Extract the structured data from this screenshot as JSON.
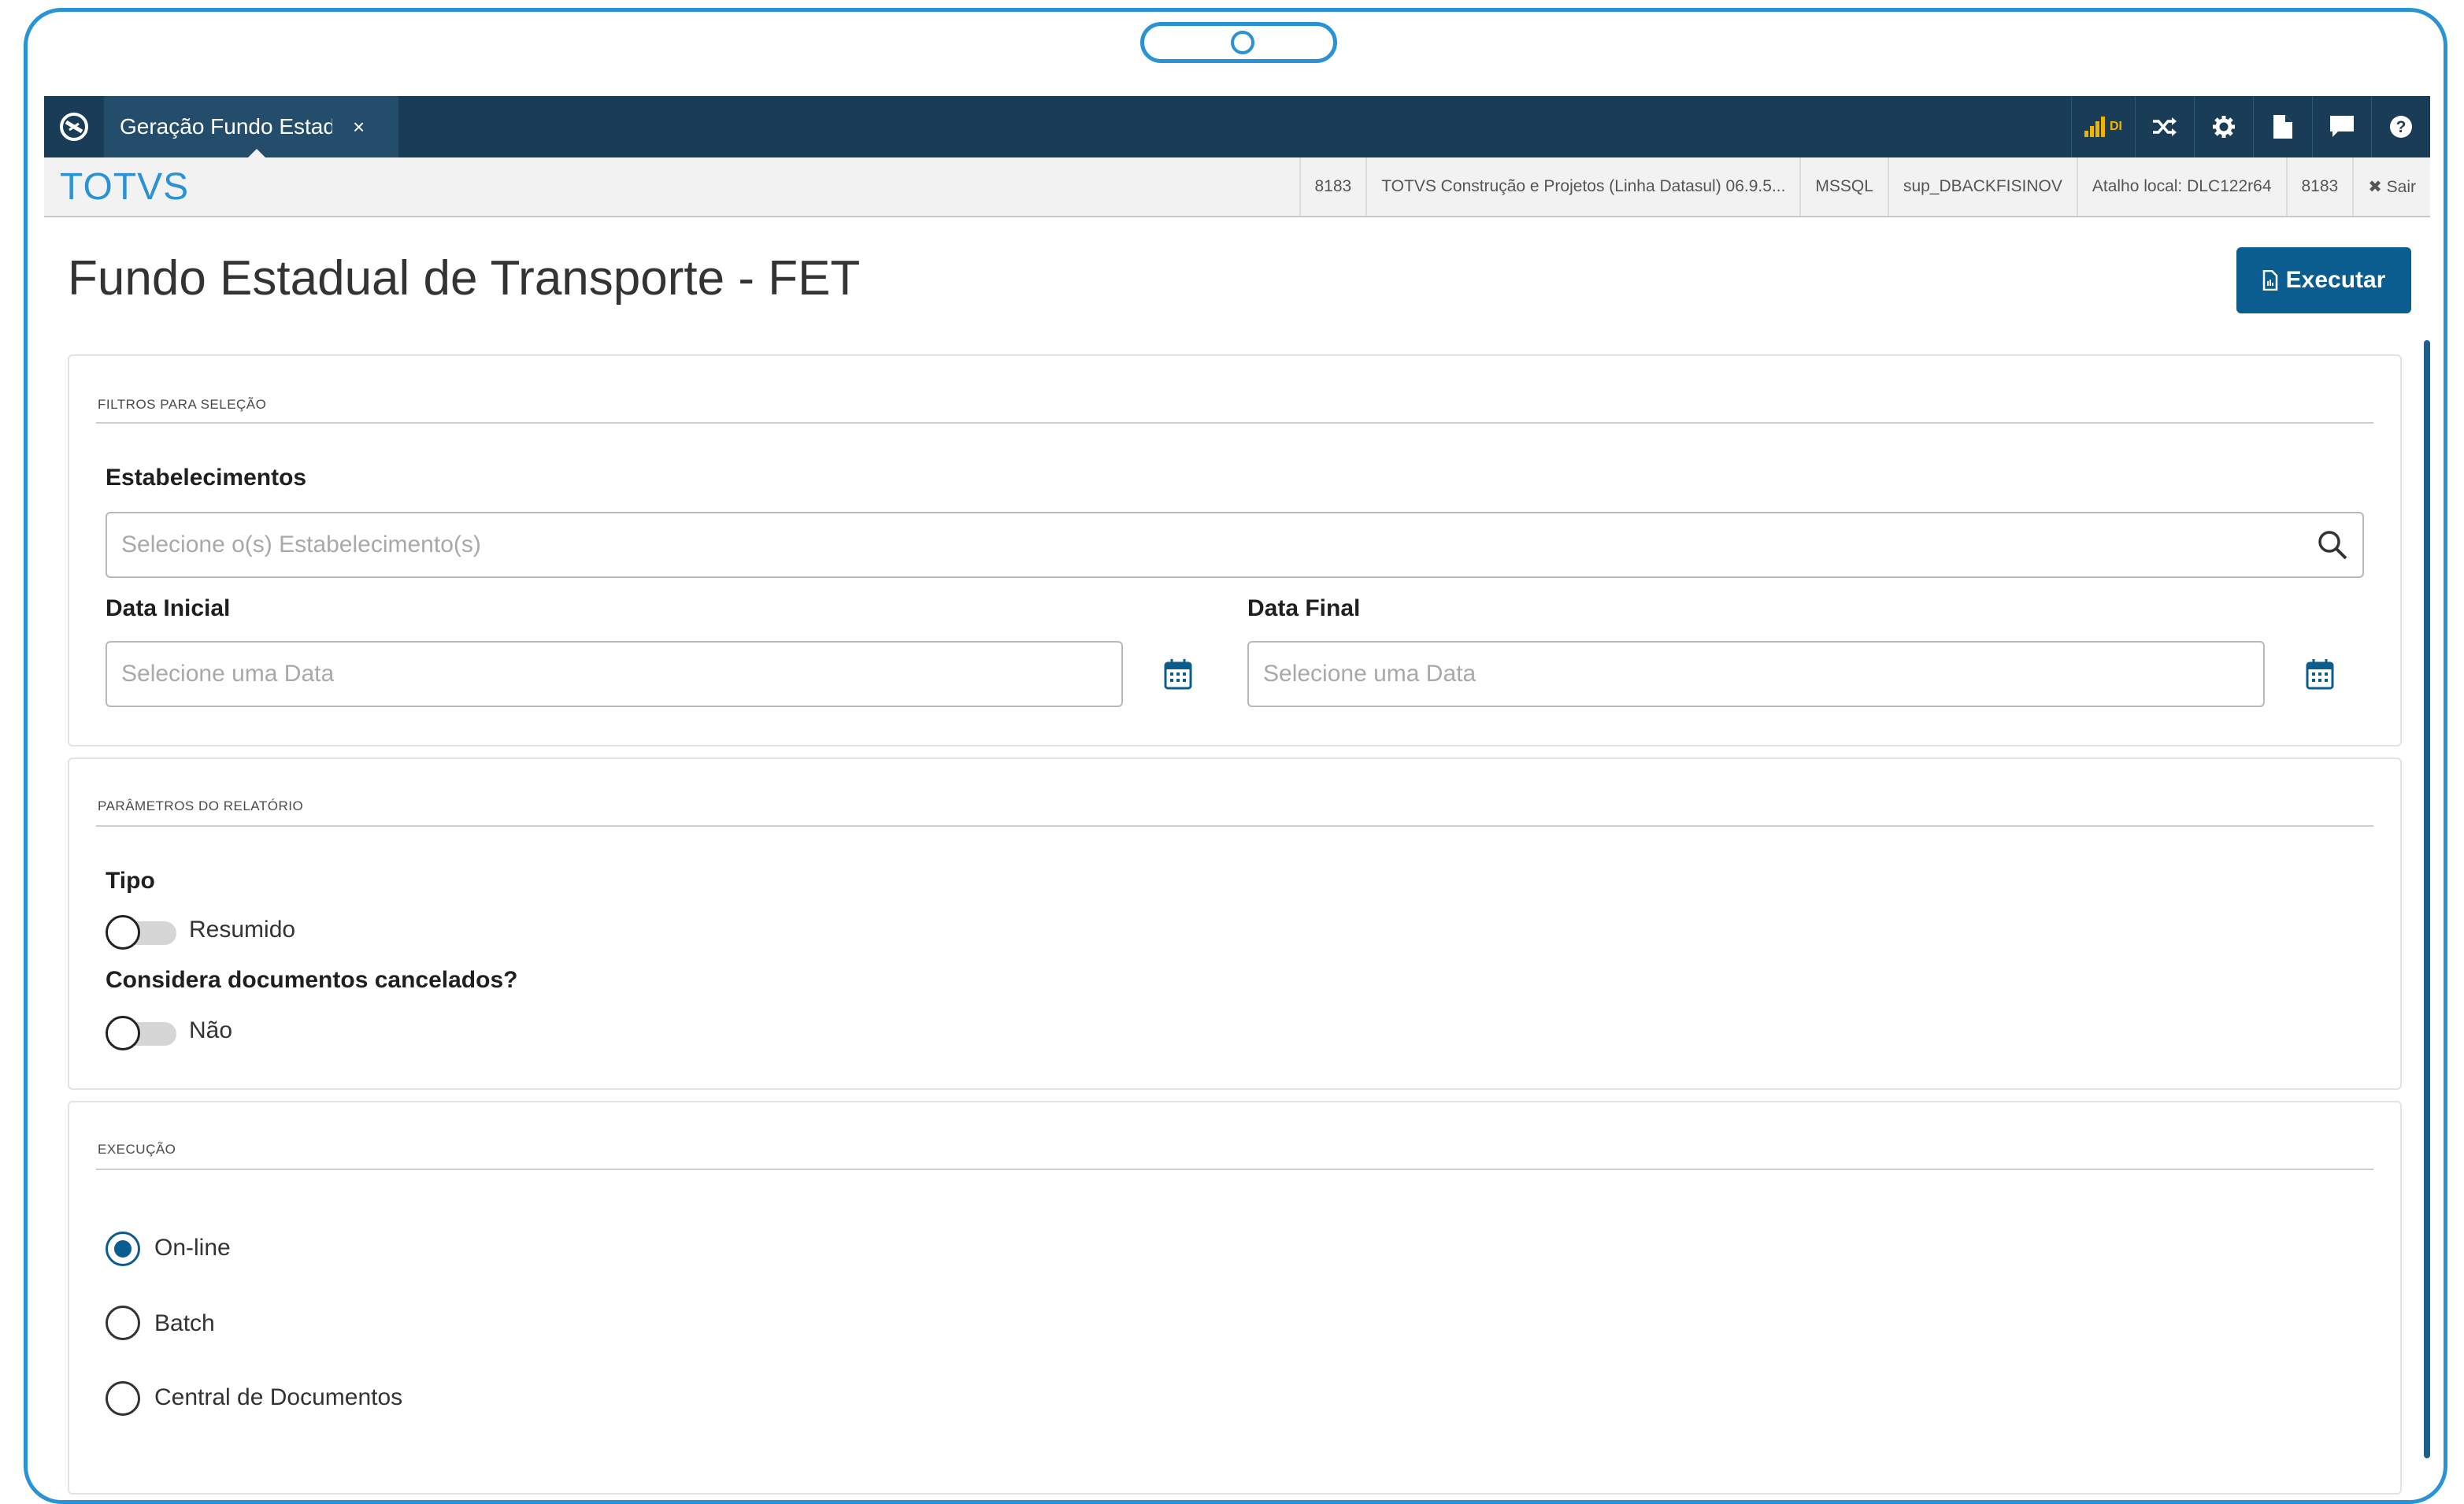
{
  "tab": {
    "label": "Geração Fundo Estadual de Transporte",
    "close": "×"
  },
  "topbar": {
    "signal_badge": "DI"
  },
  "brand": "TOTVS",
  "infobar": {
    "items": [
      "8183",
      "TOTVS Construção e Projetos (Linha Datasul) 06.9.5...",
      "MSSQL",
      "sup_DBACKFISINOV",
      "Atalho local: DLC122r64",
      "8183"
    ],
    "logout": "✖ Sair"
  },
  "page": {
    "title": "Fundo Estadual de Transporte - FET",
    "execute_label": "Executar"
  },
  "filters": {
    "section_title": "FILTROS PARA SELEÇÃO",
    "establishments_label": "Estabelecimentos",
    "establishments_placeholder": "Selecione o(s) Estabelecimento(s)",
    "start_date_label": "Data Inicial",
    "start_date_placeholder": "Selecione uma Data",
    "end_date_label": "Data Final",
    "end_date_placeholder": "Selecione uma Data"
  },
  "params": {
    "section_title": "PARÂMETROS DO RELATÓRIO",
    "type_label": "Tipo",
    "type_value": "Resumido",
    "cancelled_label": "Considera documentos cancelados?",
    "cancelled_value": "Não"
  },
  "execution": {
    "section_title": "EXECUÇÃO",
    "options": [
      "On-line",
      "Batch",
      "Central de Documentos"
    ],
    "selected": "On-line"
  }
}
